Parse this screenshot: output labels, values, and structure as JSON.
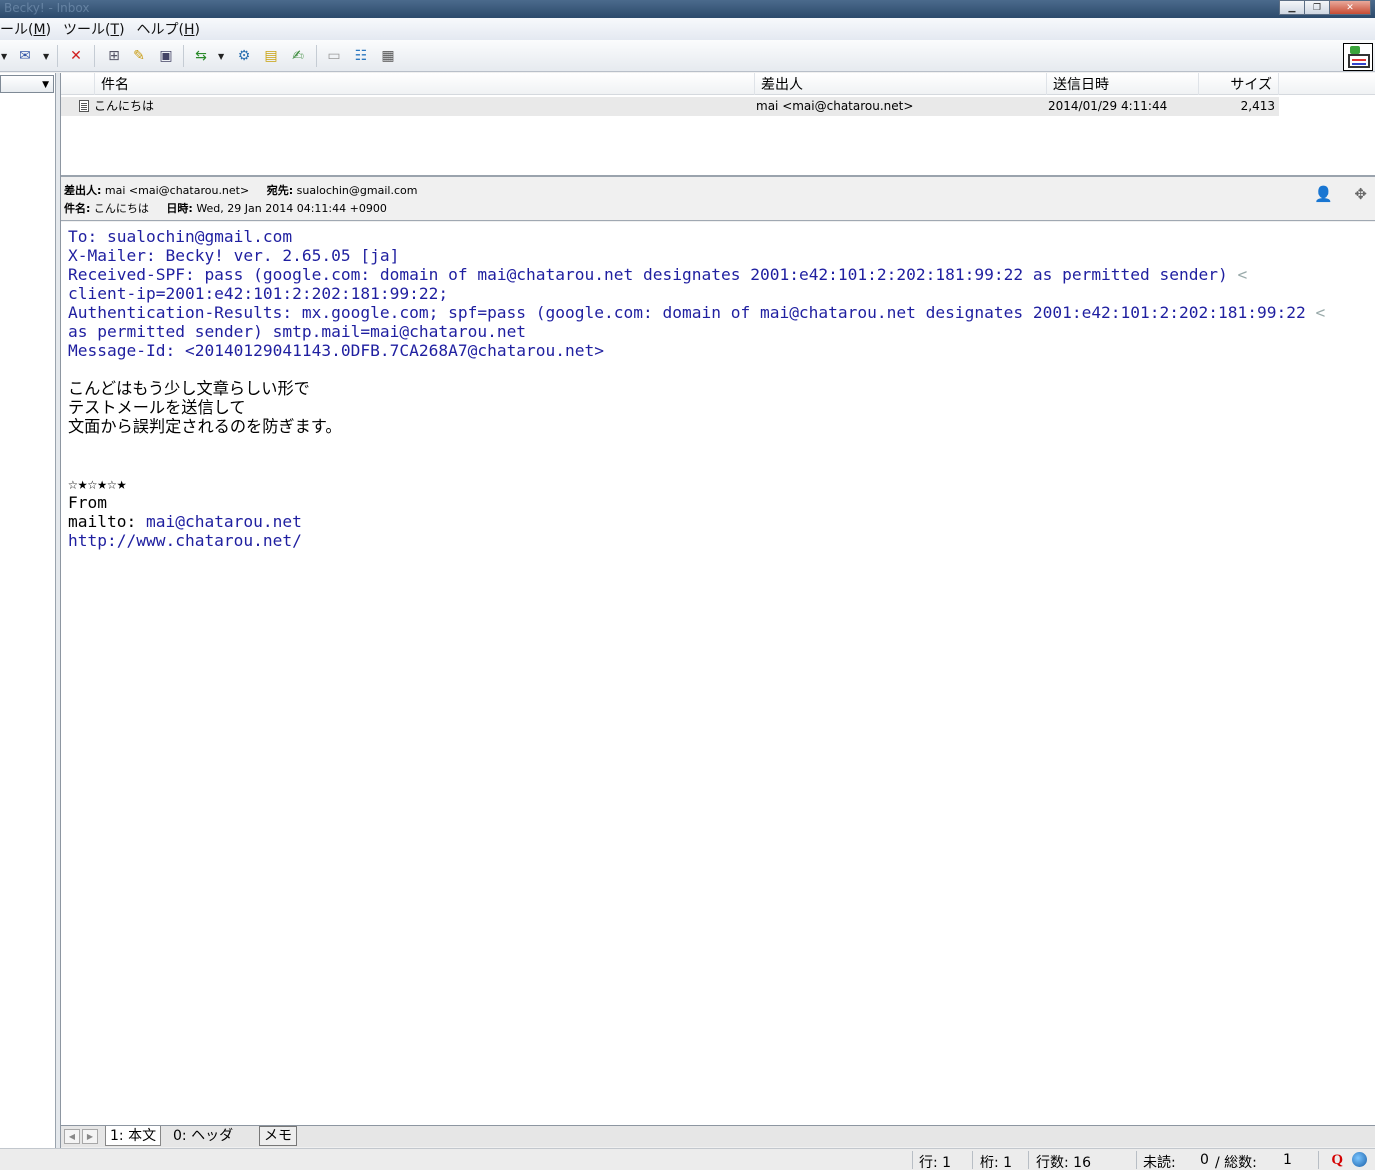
{
  "window": {
    "title": "Becky! - Inbox"
  },
  "menus": [
    {
      "label": "ール(",
      "key": "M",
      "tail": ")"
    },
    {
      "label": "ツール(",
      "key": "T",
      "tail": ")"
    },
    {
      "label": "ヘルプ(",
      "key": "H",
      "tail": ")"
    }
  ],
  "list": {
    "columns": {
      "subject": "件名",
      "from": "差出人",
      "date": "送信日時",
      "size": "サイズ"
    },
    "rows": [
      {
        "subject": "こんにちは",
        "from": "mai <mai@chatarou.net>",
        "date": "2014/01/29 4:11:44",
        "size": "2,413"
      }
    ]
  },
  "header": {
    "from_label": "差出人:",
    "from_value": "mai <mai@chatarou.net>",
    "to_label": "宛先:",
    "to_value": "sualochin@gmail.com",
    "subject_label": "件名:",
    "subject_value": "こんにちは",
    "date_label": "日時:",
    "date_value": "Wed, 29 Jan 2014 04:11:44 +0900"
  },
  "body": {
    "lines": [
      {
        "pre": "To: ",
        "link": "sualochin@gmail.com",
        "post": ""
      },
      {
        "pre": "X-Mailer: Becky! ver. 2.65.05 [ja]",
        "link": "",
        "post": ""
      },
      {
        "pre": "Received-SPF: pass (google.com: domain of ",
        "link": "mai@chatarou.net",
        "post": " designates 2001:e42:101:2:202:181:99:22 as permitted sender) ",
        "wrap": "<"
      },
      {
        "pre": "client-ip=2001:e42:101:2:202:181:99:22;",
        "link": "",
        "post": ""
      },
      {
        "pre": "Authentication-Results: mx.google.com; spf=pass (google.com: domain of ",
        "link": "mai@chatarou.net",
        "post": " designates 2001:e42:101:2:202:181:99:22 ",
        "wrap": "<"
      },
      {
        "pre": "as permitted sender) smtp.mail=",
        "link": "mai@chatarou.net",
        "post": ""
      },
      {
        "pre": "Message-Id: <",
        "link": "20140129041143.0DFB.7CA268A7@chatarou.net",
        "post": ">"
      },
      {
        "pre": "",
        "link": "",
        "post": ""
      },
      {
        "pre": "こんどはもう少し文章らしい形で",
        "link": "",
        "post": ""
      },
      {
        "pre": "テストメールを送信して",
        "link": "",
        "post": ""
      },
      {
        "pre": "文面から誤判定されるのを防ぎます。",
        "link": "",
        "post": ""
      },
      {
        "pre": "",
        "link": "",
        "post": ""
      },
      {
        "pre": "",
        "link": "",
        "post": ""
      },
      {
        "pre": "☆★☆★☆★",
        "link": "",
        "post": ""
      },
      {
        "pre": "From",
        "link": "",
        "post": ""
      },
      {
        "pre": "mailto: ",
        "link": "mai@chatarou.net",
        "post": ""
      },
      {
        "pre": "",
        "link": "http://www.chatarou.net/",
        "post": ""
      }
    ]
  },
  "tabs": {
    "body": "1: 本文",
    "header": "0: ヘッダ",
    "memo": "メモ"
  },
  "status": {
    "row_label": "行: 1",
    "col_label": "桁: 1",
    "lines_label": "行数: 16",
    "unread_label": "未読:",
    "unread_value": "0",
    "total_label": "/ 総数:",
    "total_value": "1"
  },
  "colors": {
    "link": "#1f1fa0",
    "selected_row": "#e9e9e9"
  }
}
